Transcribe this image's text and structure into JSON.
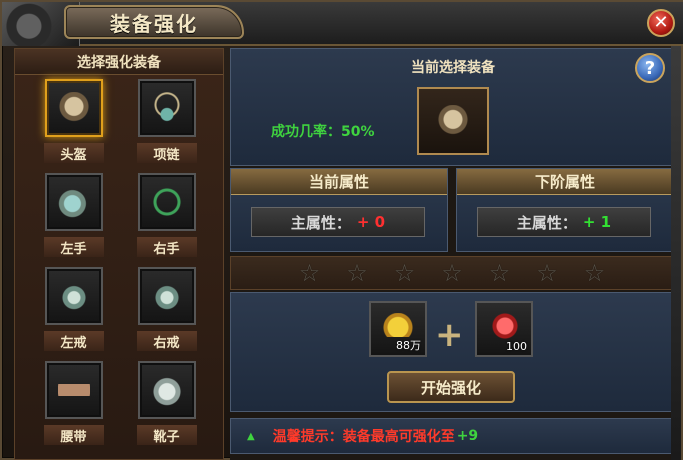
{
  "window": {
    "title": "装备强化",
    "close_icon": "close-icon",
    "help_icon": "help-icon"
  },
  "left_panel": {
    "header": "选择强化装备",
    "items": [
      {
        "label": "头盔",
        "icon": "helmet-icon",
        "selected": true
      },
      {
        "label": "项链",
        "icon": "necklace-icon",
        "selected": false
      },
      {
        "label": "左手",
        "icon": "left-bracer-icon",
        "selected": false
      },
      {
        "label": "右手",
        "icon": "right-bracelet-icon",
        "selected": false
      },
      {
        "label": "左戒",
        "icon": "left-ring-icon",
        "selected": false
      },
      {
        "label": "右戒",
        "icon": "right-ring-icon",
        "selected": false
      },
      {
        "label": "腰带",
        "icon": "belt-icon",
        "selected": false
      },
      {
        "label": "靴子",
        "icon": "boots-icon",
        "selected": false
      }
    ]
  },
  "current": {
    "label": "当前选择装备",
    "success_rate": "成功几率：50%",
    "item_icon": "helmet-icon"
  },
  "attributes": {
    "current": {
      "header": "当前属性",
      "name": "主属性：",
      "value": "+ 0",
      "color": "#ff3030"
    },
    "next": {
      "header": "下阶属性",
      "name": "主属性：",
      "value": "+ 1",
      "color": "#33e033"
    }
  },
  "stars": {
    "total": 7,
    "filled": 0
  },
  "materials": {
    "gold": {
      "icon": "gold-ingot-icon",
      "count": "88万"
    },
    "plus_symbol": "+",
    "stone": {
      "icon": "red-stone-icon",
      "count": "100"
    }
  },
  "start_button": "开始强化",
  "tip": {
    "text": "温馨提示：装备最高可强化至",
    "level": "+9"
  }
}
